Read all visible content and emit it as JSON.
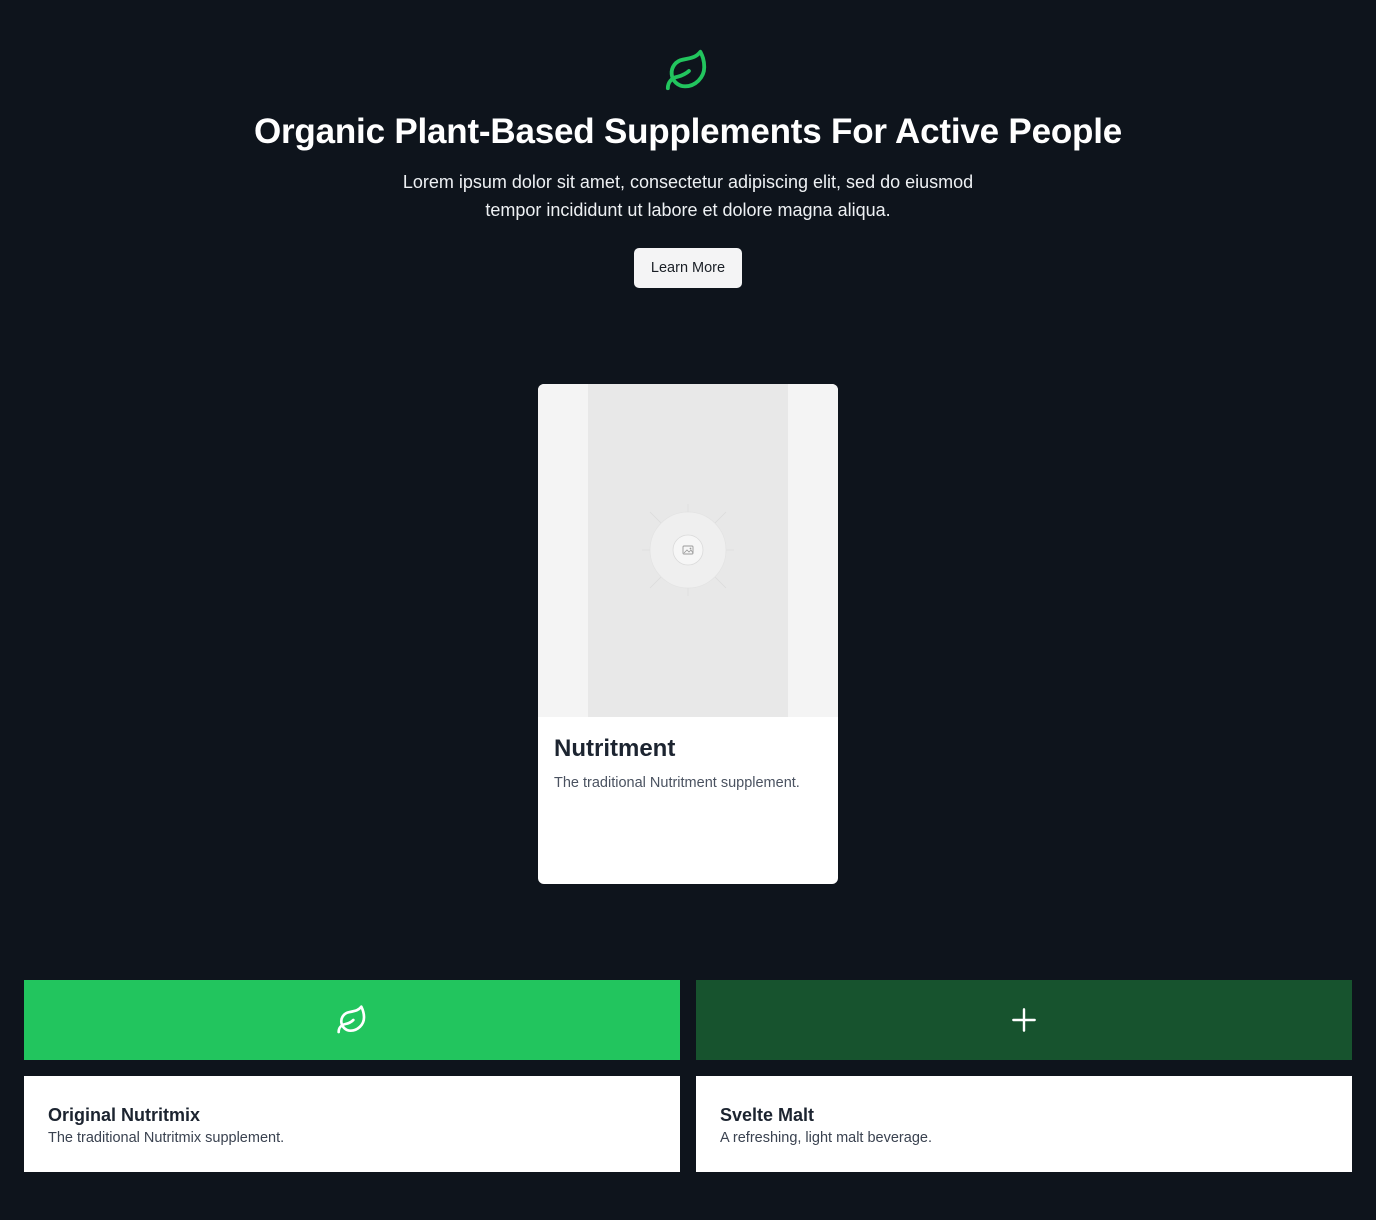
{
  "hero": {
    "icon": "leaf-icon",
    "title": "Organic Plant-Based Supplements For Active People",
    "subtitle_line1": "Lorem ipsum dolor sit amet, consectetur adipiscing elit, sed do eiusmod",
    "subtitle_line2": "tempor incididunt ut labore et dolore magna aliqua.",
    "button_label": "Learn More"
  },
  "featured": {
    "image_icon": "image-placeholder-icon",
    "title": "Nutritment",
    "description": "The traditional Nutritment supplement."
  },
  "products": [
    {
      "icon": "leaf-icon",
      "tile_color": "#22c55e",
      "title": "Original Nutritmix",
      "description": "The traditional Nutritmix supplement."
    },
    {
      "icon": "plus-icon",
      "tile_color": "#17532e",
      "title": "Svelte Malt",
      "description": "A refreshing, light malt beverage."
    }
  ],
  "colors": {
    "background": "#0e141c",
    "accent": "#22c55e",
    "accent_dark": "#17532e"
  }
}
